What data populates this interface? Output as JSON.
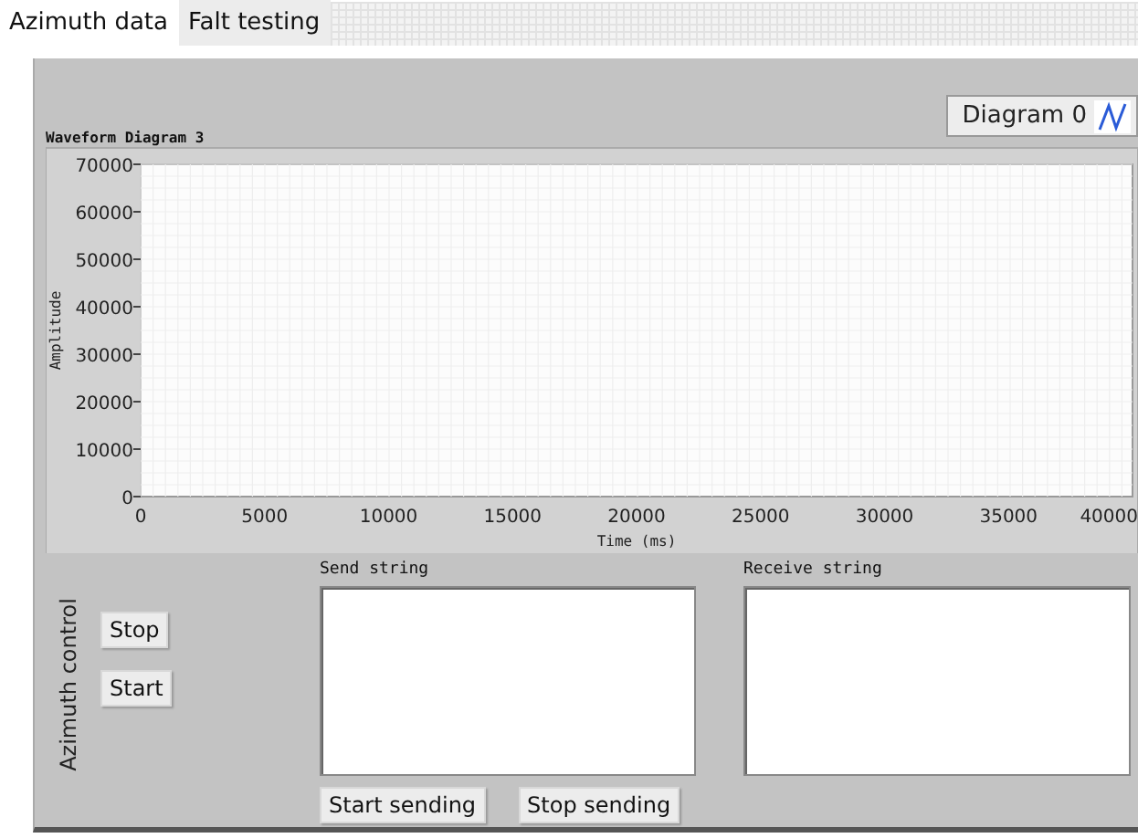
{
  "tabs": [
    {
      "label": "Azimuth data",
      "selected": true
    },
    {
      "label": "Falt testing",
      "selected": false
    }
  ],
  "chart": {
    "chart_data": {
      "type": "line",
      "title": "Waveform Diagram 3",
      "xlabel": "Time (ms)",
      "ylabel": "Amplitude",
      "grid": true,
      "categories": [
        "0",
        "5000",
        "10000",
        "15000",
        "20000",
        "25000",
        "30000",
        "35000",
        "40000"
      ],
      "ylim": [
        0,
        70000
      ],
      "yticks": [
        0,
        10000,
        20000,
        30000,
        40000,
        50000,
        60000,
        70000
      ],
      "series": [
        {
          "name": "Diagram 0",
          "color": "#2a5bd7",
          "values": [
            null,
            null,
            null,
            null,
            null,
            null,
            null,
            null,
            null
          ]
        }
      ]
    }
  },
  "azimuth_control": {
    "label": "Azimuth control",
    "buttons": [
      "Stop",
      "Start"
    ]
  },
  "send": {
    "label": "Send string"
  },
  "receive": {
    "label": "Receive string"
  },
  "send_buttons": [
    "Start sending",
    "Stop sending"
  ]
}
